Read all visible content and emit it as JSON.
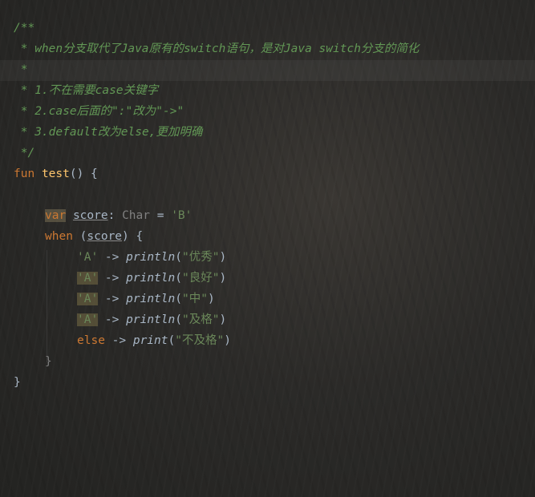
{
  "editor": {
    "comment": {
      "open": "/**",
      "line1": " * when分支取代了Java原有的switch语句，是对Java switch分支的简化",
      "line2": " *",
      "line3": " * 1.不在需要case关键字",
      "line4": " * 2.case后面的\":\"改为\"->\"",
      "line5": " * 3.default改为else,更加明确",
      "close": " */"
    },
    "func": {
      "keyword": "fun",
      "name": "test",
      "signature": "() {"
    },
    "decl": {
      "keyword": "var",
      "name": "score",
      "colon": ":",
      "type": "Char",
      "assign": " = ",
      "value": "'B'"
    },
    "when": {
      "keyword": "when",
      "open_paren": " (",
      "subject": "score",
      "close": ") {"
    },
    "branches": [
      {
        "cond": "'A'",
        "arrow": " -> ",
        "call": "println",
        "open": "(",
        "arg": "\"优秀\"",
        "close": ")"
      },
      {
        "cond": "'A'",
        "arrow": " -> ",
        "call": "println",
        "open": "(",
        "arg": "\"良好\"",
        "close": ")"
      },
      {
        "cond": "'A'",
        "arrow": " -> ",
        "call": "println",
        "open": "(",
        "arg": "\"中\"",
        "close": ")"
      },
      {
        "cond": "'A'",
        "arrow": " -> ",
        "call": "println",
        "open": "(",
        "arg": "\"及格\"",
        "close": ")"
      }
    ],
    "else_branch": {
      "keyword": "else",
      "arrow": " -> ",
      "call": "print",
      "open": "(",
      "arg": "\"不及格\"",
      "close": ")"
    },
    "when_close": "}",
    "func_close": "}"
  }
}
